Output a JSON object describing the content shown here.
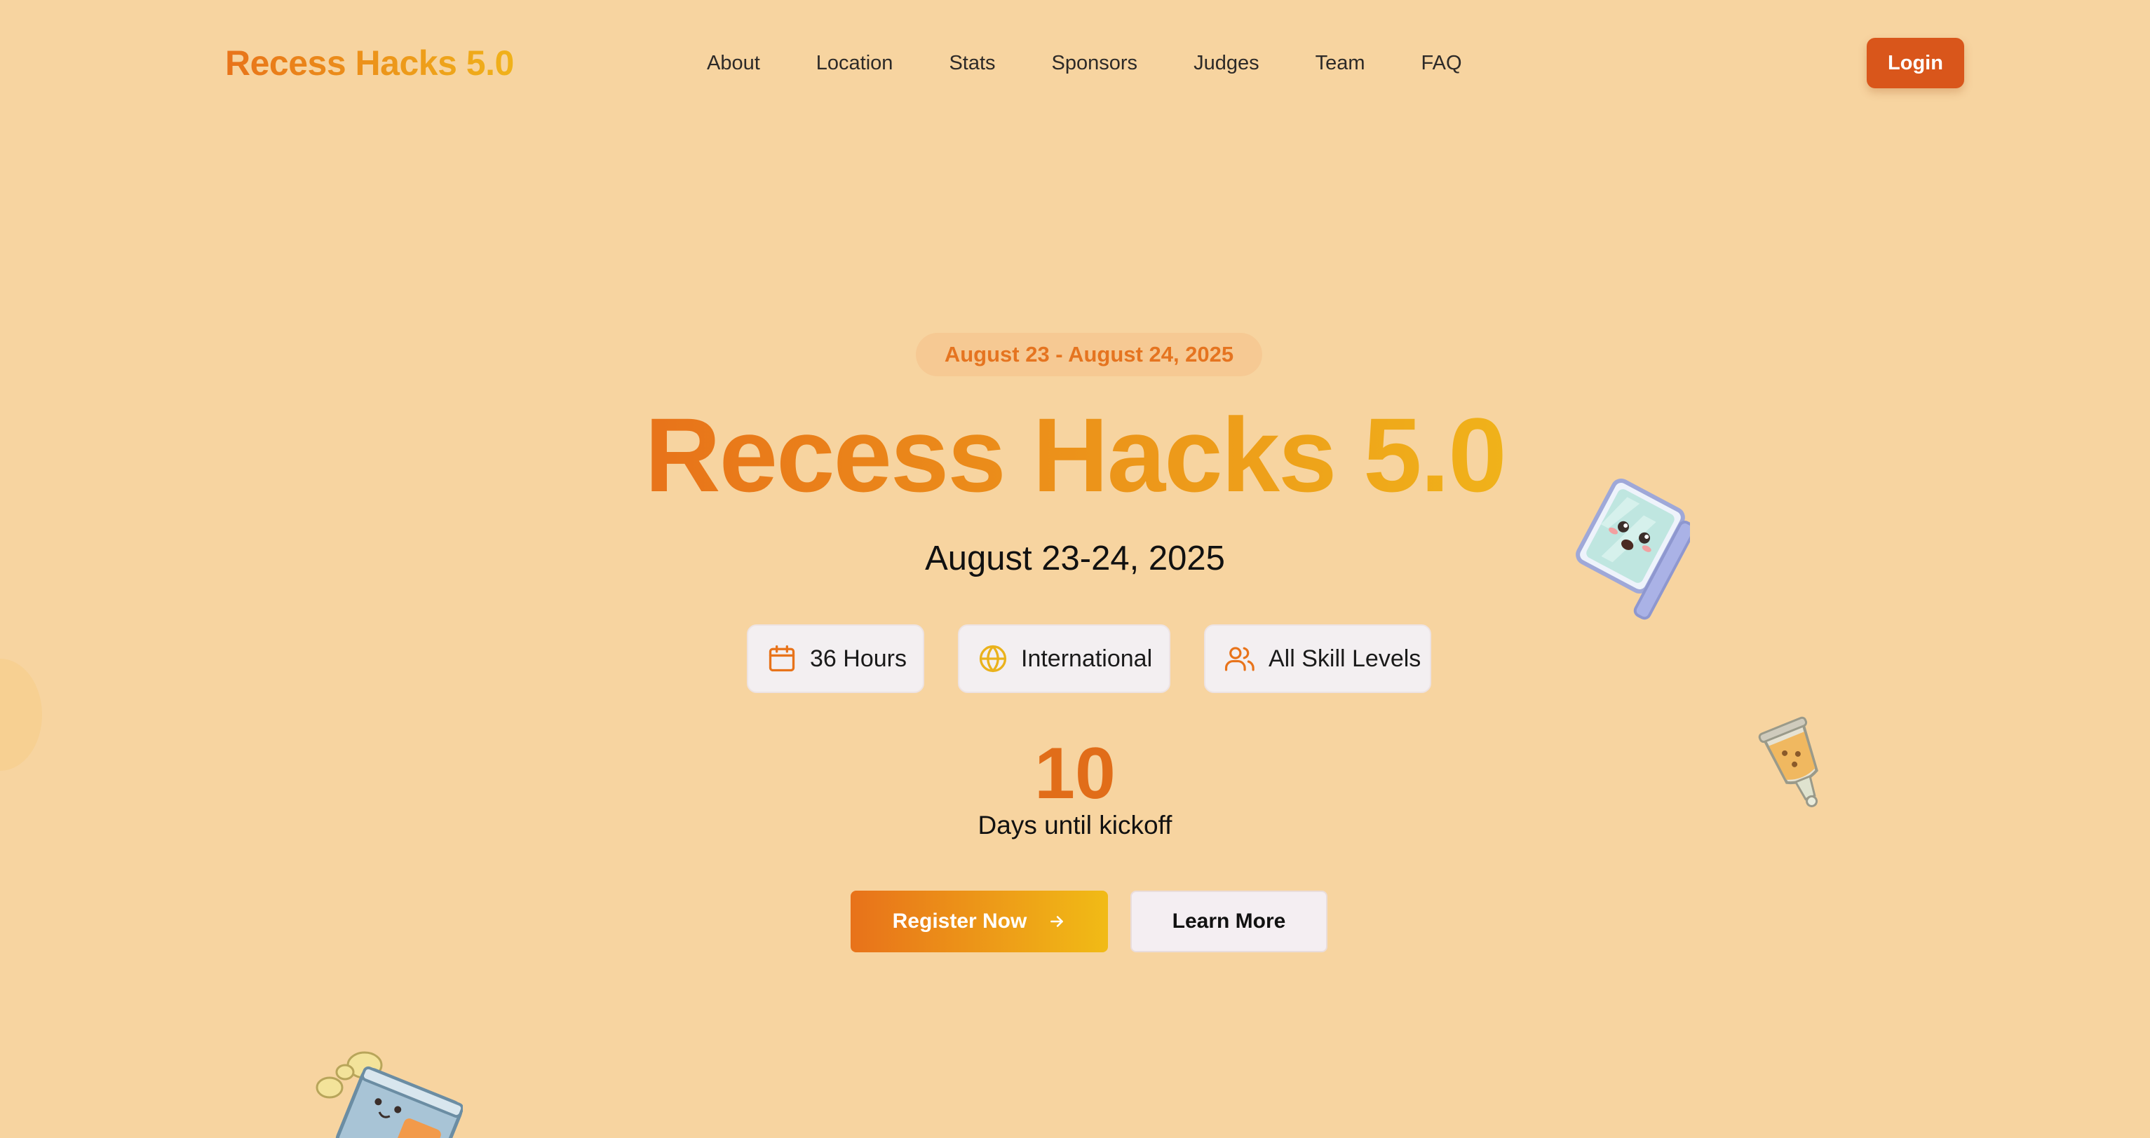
{
  "nav": {
    "brand": "Recess Hacks 5.0",
    "links": [
      "About",
      "Location",
      "Stats",
      "Sponsors",
      "Judges",
      "Team",
      "FAQ"
    ],
    "login_label": "Login"
  },
  "hero": {
    "date_pill": "August 23 - August 24, 2025",
    "title": "Recess Hacks 5.0",
    "date": "August 23-24, 2025",
    "features": [
      {
        "icon": "calendar-icon",
        "label": "36 Hours"
      },
      {
        "icon": "globe-icon",
        "label": "International"
      },
      {
        "icon": "users-icon",
        "label": "All Skill Levels"
      }
    ],
    "countdown": {
      "value": "10",
      "label": "Days until kickoff"
    },
    "register_label": "Register Now",
    "learn_more_label": "Learn More"
  },
  "colors": {
    "background": "#f7d4a0",
    "accent_orange": "#e8731a",
    "accent_yellow": "#f0b21a",
    "login_button": "#d9561b"
  },
  "stickers": [
    "laptop-sticker",
    "bubble-tea-sticker",
    "chips-sticker"
  ]
}
